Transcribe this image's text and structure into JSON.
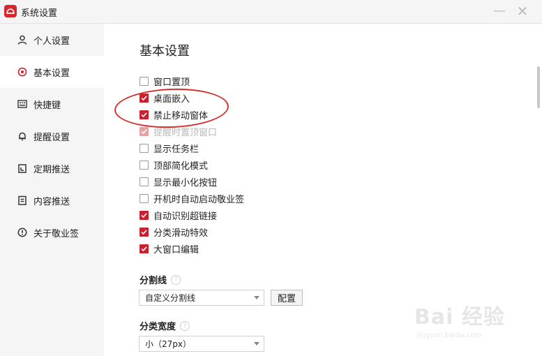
{
  "window": {
    "title": "系统设置",
    "minimize_glyph": "—",
    "close_glyph": "✕"
  },
  "sidebar": {
    "items": [
      {
        "label": "个人设置",
        "icon": "person-icon",
        "active": false
      },
      {
        "label": "基本设置",
        "icon": "settings-target-icon",
        "active": true
      },
      {
        "label": "快捷键",
        "icon": "keyboard-icon",
        "active": false
      },
      {
        "label": "提醒设置",
        "icon": "bell-icon",
        "active": false
      },
      {
        "label": "定期推送",
        "icon": "calendar-icon",
        "active": false
      },
      {
        "label": "内容推送",
        "icon": "document-icon",
        "active": false
      },
      {
        "label": "关于敬业签",
        "icon": "info-icon",
        "active": false
      }
    ]
  },
  "main": {
    "section_title": "基本设置",
    "options": [
      {
        "label": "窗口置顶",
        "checked": false,
        "disabled": false
      },
      {
        "label": "桌面嵌入",
        "checked": true,
        "disabled": false
      },
      {
        "label": "禁止移动窗体",
        "checked": true,
        "disabled": false
      },
      {
        "label": "提醒时置顶窗口",
        "checked": true,
        "disabled": true
      },
      {
        "label": "显示任务栏",
        "checked": false,
        "disabled": false
      },
      {
        "label": "顶部简化模式",
        "checked": false,
        "disabled": false
      },
      {
        "label": "显示最小化按钮",
        "checked": false,
        "disabled": false
      },
      {
        "label": "开机时自动启动敬业签",
        "checked": false,
        "disabled": false
      },
      {
        "label": "自动识别超链接",
        "checked": true,
        "disabled": false
      },
      {
        "label": "分类滑动特效",
        "checked": true,
        "disabled": false
      },
      {
        "label": "大窗口编辑",
        "checked": true,
        "disabled": false
      }
    ],
    "divider": {
      "label": "分割线",
      "help": "?",
      "selected": "自定义分割线",
      "config_button": "配置"
    },
    "category_width": {
      "label": "分类宽度",
      "help": "?",
      "selected": "小（27px）"
    }
  },
  "watermark": {
    "text": "Bai 经验",
    "sub": "jingyan.baidu.com"
  },
  "colors": {
    "accent": "#c8202c",
    "sidebar_bg": "#f5f5f5",
    "annotation": "#d6302e"
  }
}
